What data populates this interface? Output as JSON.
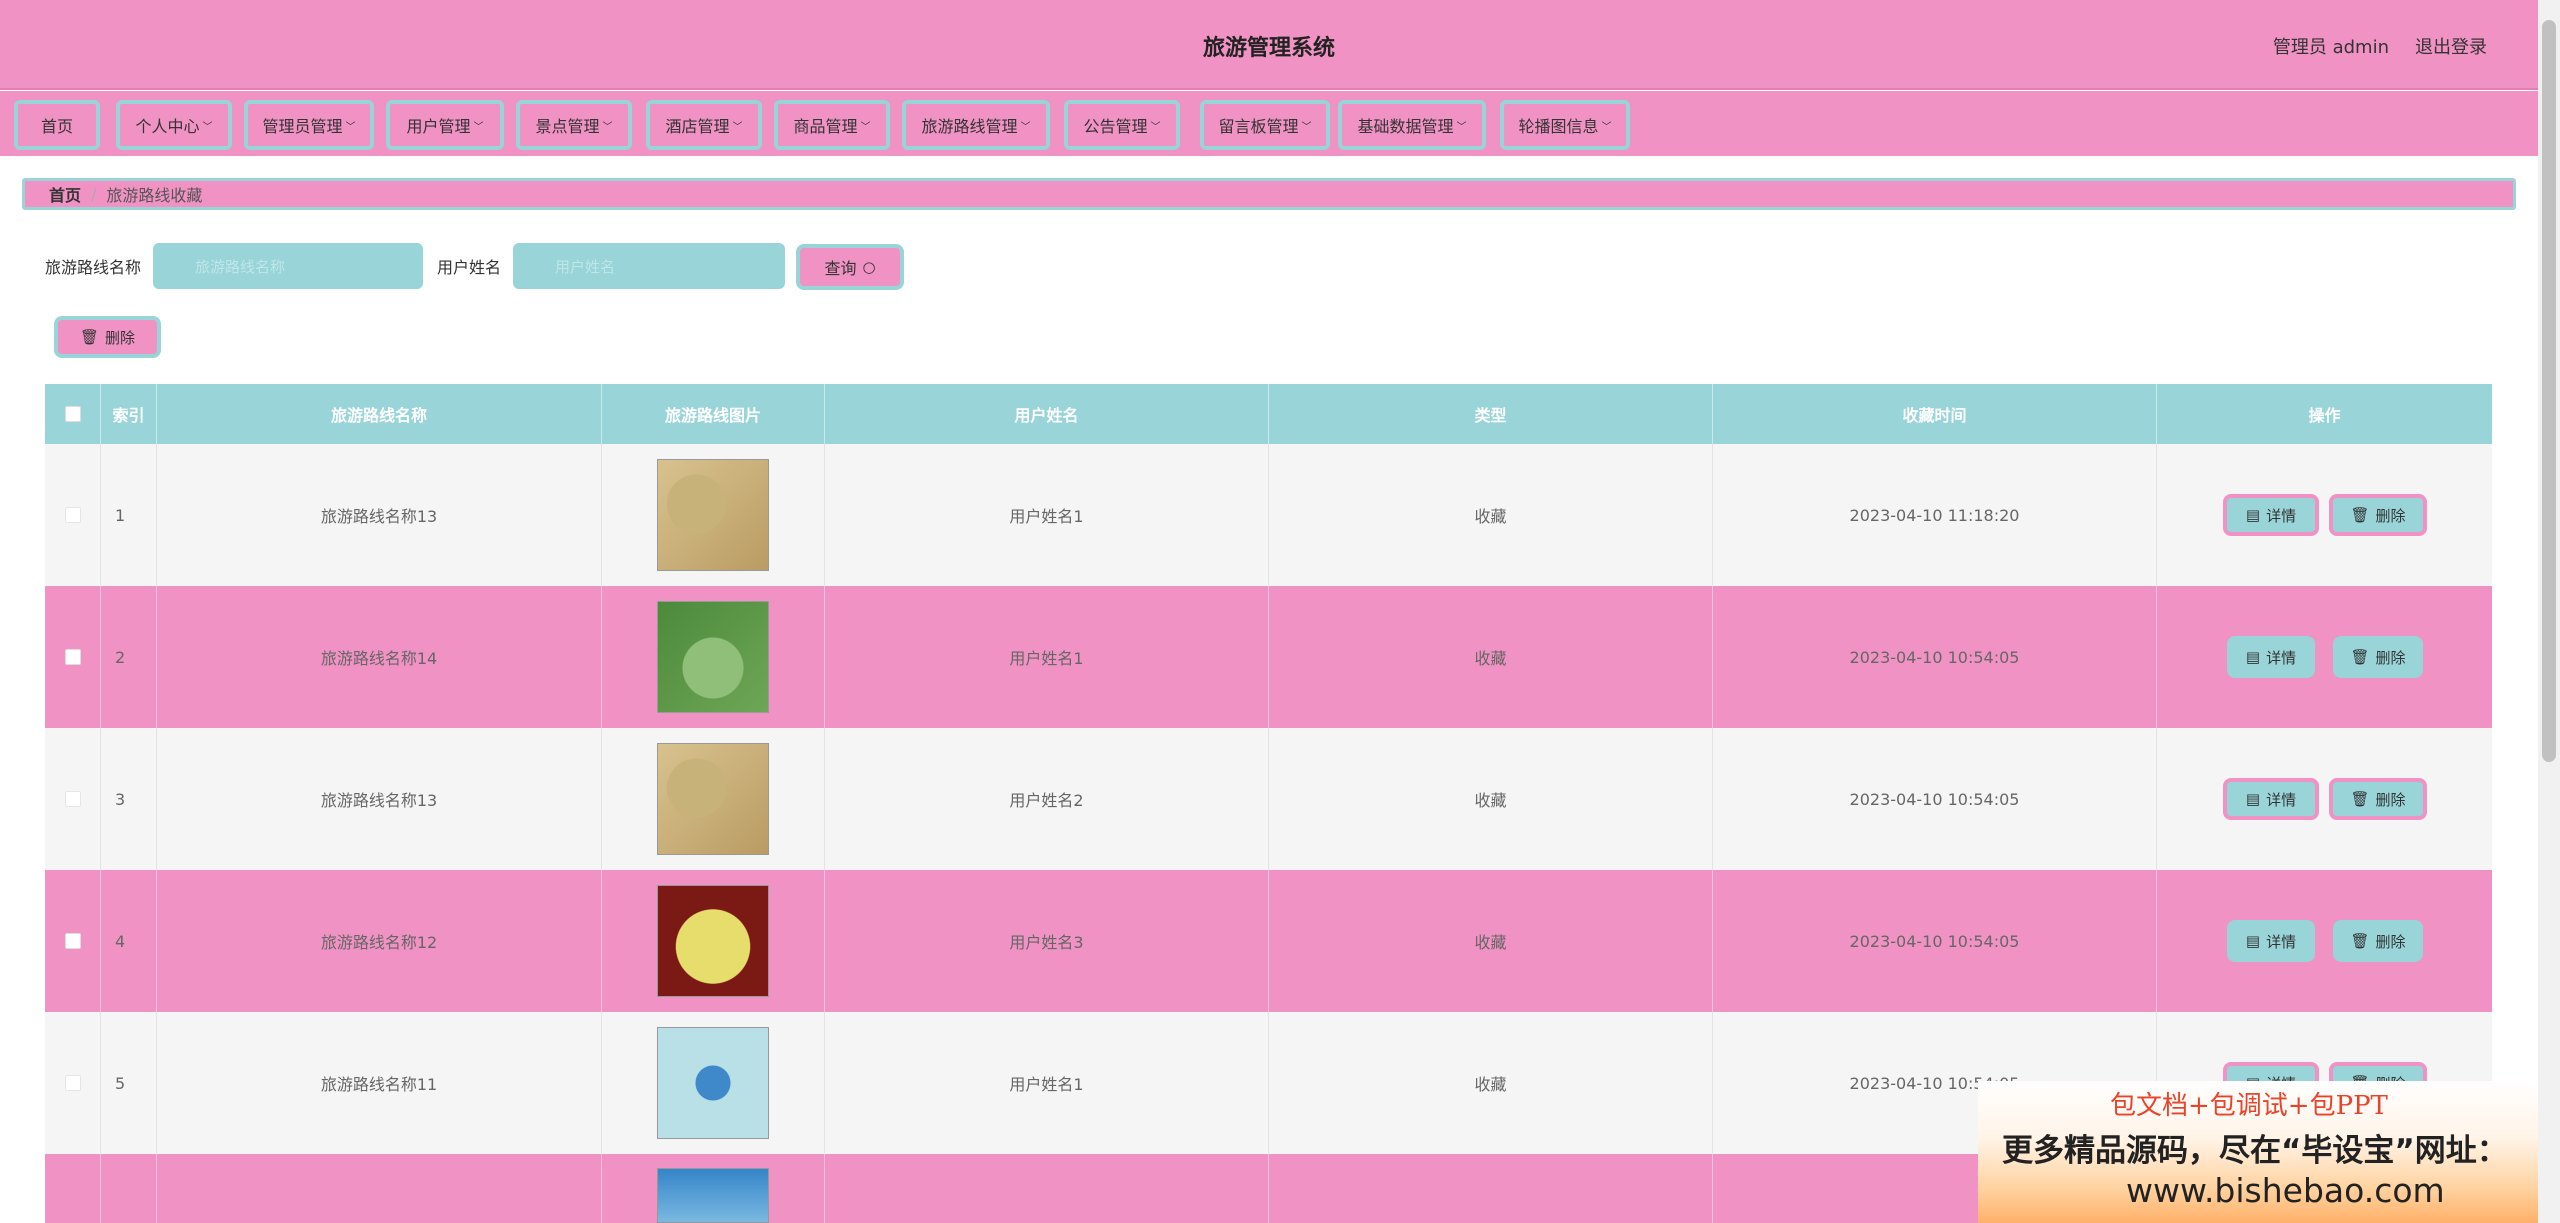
{
  "header": {
    "title": "旅游管理系统",
    "user": "管理员 admin",
    "logout": "退出登录"
  },
  "nav": [
    {
      "label": "首页",
      "dropdown": false
    },
    {
      "label": "个人中心",
      "dropdown": true
    },
    {
      "label": "管理员管理",
      "dropdown": true
    },
    {
      "label": "用户管理",
      "dropdown": true
    },
    {
      "label": "景点管理",
      "dropdown": true
    },
    {
      "label": "酒店管理",
      "dropdown": true
    },
    {
      "label": "商品管理",
      "dropdown": true
    },
    {
      "label": "旅游路线管理",
      "dropdown": true
    },
    {
      "label": "公告管理",
      "dropdown": true
    },
    {
      "label": "留言板管理",
      "dropdown": true
    },
    {
      "label": "基础数据管理",
      "dropdown": true
    },
    {
      "label": "轮播图信息",
      "dropdown": true
    }
  ],
  "breadcrumb": {
    "home": "首页",
    "current": "旅游路线收藏"
  },
  "search": {
    "route_label": "旅游路线名称",
    "route_placeholder": "旅游路线名称",
    "user_label": "用户姓名",
    "user_placeholder": "用户姓名",
    "query_label": "查询"
  },
  "toolbar": {
    "delete_label": "删除"
  },
  "table": {
    "headers": [
      "索引",
      "旅游路线名称",
      "旅游路线图片",
      "用户姓名",
      "类型",
      "收藏时间",
      "操作"
    ],
    "rows": [
      {
        "index": "1",
        "route": "旅游路线名称13",
        "user": "用户姓名1",
        "type": "收藏",
        "time": "2023-04-10 11:18:20"
      },
      {
        "index": "2",
        "route": "旅游路线名称14",
        "user": "用户姓名1",
        "type": "收藏",
        "time": "2023-04-10 10:54:05"
      },
      {
        "index": "3",
        "route": "旅游路线名称13",
        "user": "用户姓名2",
        "type": "收藏",
        "time": "2023-04-10 10:54:05"
      },
      {
        "index": "4",
        "route": "旅游路线名称12",
        "user": "用户姓名3",
        "type": "收藏",
        "time": "2023-04-10 10:54:05"
      },
      {
        "index": "5",
        "route": "旅游路线名称11",
        "user": "用户姓名1",
        "type": "收藏",
        "time": "2023-04-10 10:54:05"
      }
    ],
    "detail_label": "详情",
    "delete_label": "删除"
  },
  "ad": {
    "line1": "包文档+包调试+包PPT",
    "line2": "更多精品源码，尽在“毕设宝”网址：",
    "line3": "www.bishebao.com"
  },
  "colors": {
    "pink": "#f192c4",
    "teal": "#98d4d8"
  }
}
